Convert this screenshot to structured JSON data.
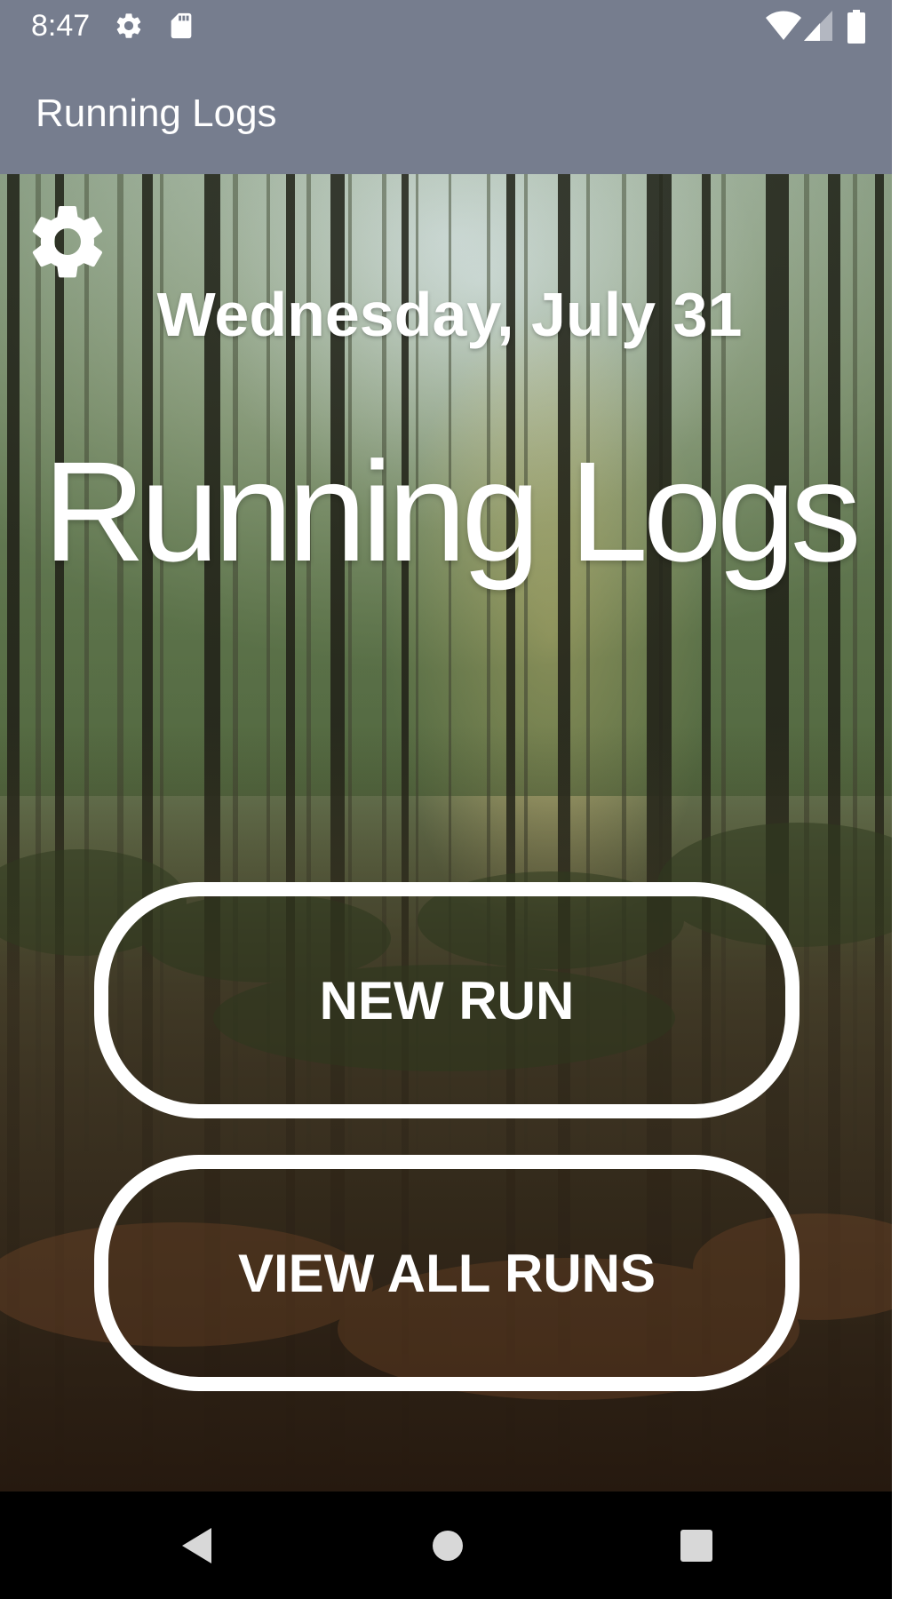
{
  "status_bar": {
    "time": "8:47",
    "icons": [
      "settings-icon",
      "sd-card-icon",
      "wifi-icon",
      "signal-icon",
      "battery-icon"
    ]
  },
  "app_bar": {
    "title": "Running Logs"
  },
  "main": {
    "settings_icon": "gear-icon",
    "date": "Wednesday, July 31",
    "title": "Running Logs",
    "new_run_label": "NEW RUN",
    "view_all_runs_label": "VIEW ALL RUNS"
  },
  "nav_bar": {
    "buttons": [
      "back-icon",
      "home-icon",
      "recents-icon"
    ]
  },
  "colors": {
    "toolbar": "#767d8e",
    "text": "#ffffff",
    "nav_bar": "#000000"
  }
}
